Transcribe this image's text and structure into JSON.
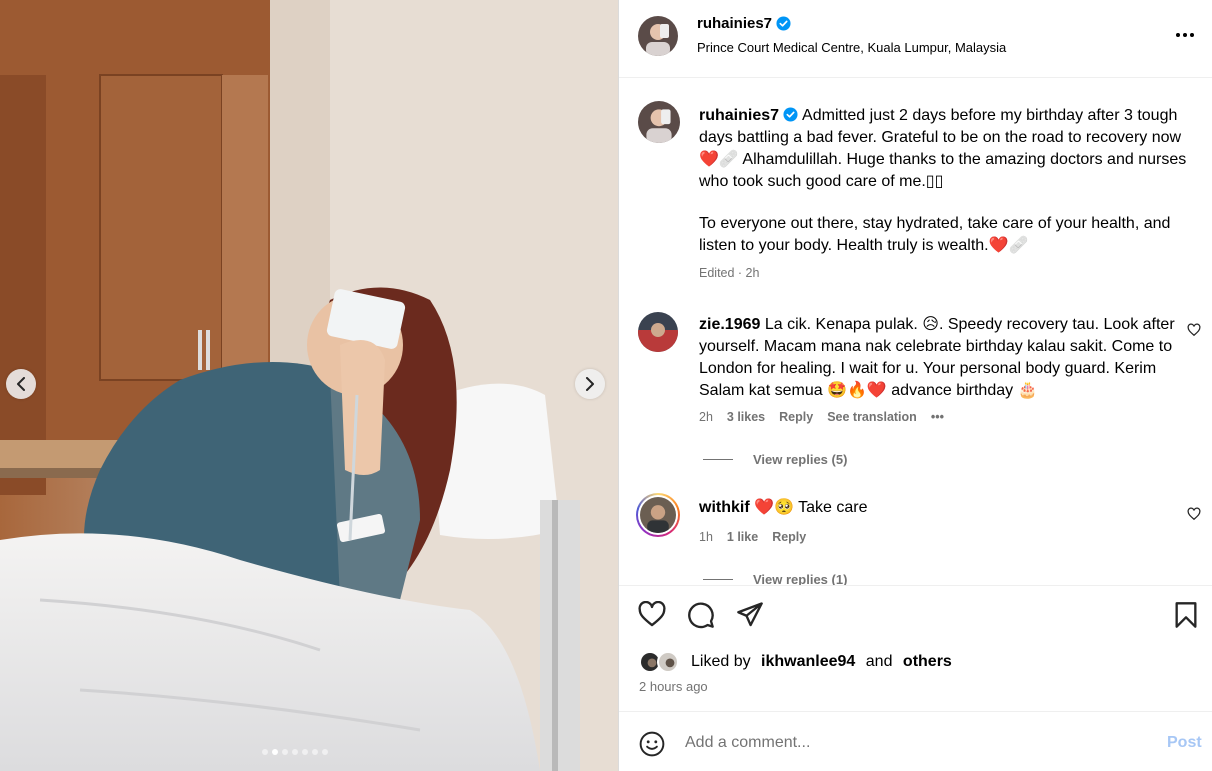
{
  "post": {
    "username": "ruhainies7",
    "location": "Prince Court Medical Centre, Kuala Lumpur, Malaysia",
    "caption_p1": "Admitted just 2 days before my birthday after 3 tough days battling a bad fever. Grateful to be on the road to recovery now ❤️🩹 Alhamdulillah. Huge thanks to the amazing doctors and nurses who took such good care of me.▯▯",
    "caption_p2": "To everyone out there, stay hydrated, take care of your health, and listen to your body. Health truly is wealth.❤️🩹",
    "edited": "Edited · 2h",
    "carousel_slides": 7,
    "carousel_active_index": 1
  },
  "comments": [
    {
      "username": "zie.1969",
      "text": "La cik. Kenapa pulak. 😥. Speedy recovery tau. Look after yourself. Macam mana nak celebrate birthday kalau sakit. Come to London for healing. I wait for u. Your personal body guard. Kerim Salam kat semua 🤩🔥❤️ advance birthday 🎂",
      "time": "2h",
      "likes": "3 likes",
      "reply": "Reply",
      "translate": "See translation",
      "more": "•••",
      "view_replies": "View replies (5)"
    },
    {
      "username": "withkif",
      "text": "❤️🥺 Take care",
      "time": "1h",
      "likes": "1 like",
      "reply": "Reply",
      "view_replies": "View replies (1)"
    }
  ],
  "liked_by": {
    "prefix": "Liked by ",
    "user": "ikhwanlee94",
    "joiner": " and ",
    "others": "others"
  },
  "time_ago": "2 hours ago",
  "add_comment": {
    "placeholder": "Add a comment...",
    "post_label": "Post"
  },
  "colors": {
    "accent": "#0095f6",
    "post_disabled": "#a7c7f5",
    "muted": "#737373",
    "verified": "#0095f6"
  },
  "icons": {
    "prev": "chevron-left-icon",
    "next": "chevron-right-icon",
    "like": "heart-icon",
    "comment": "comment-icon",
    "share": "share-icon",
    "save": "bookmark-icon",
    "more": "more-icon",
    "emoji": "emoji-icon"
  }
}
